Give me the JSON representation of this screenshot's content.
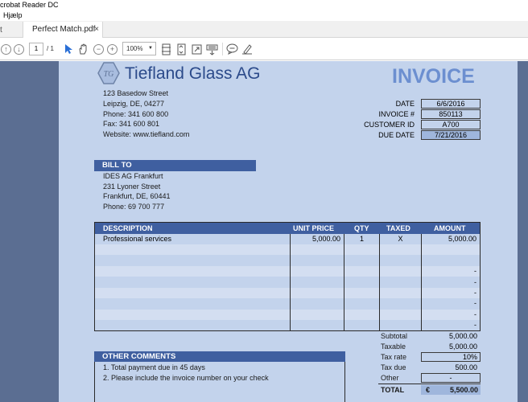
{
  "app": {
    "title": "crobat Reader DC",
    "menu": "Hjælp"
  },
  "tabs": {
    "left_stub": "t",
    "doc_tab": "Perfect Match.pdf",
    "close": "×"
  },
  "toolbar": {
    "page_current": "1",
    "page_total": "/ 1",
    "zoom": "100%"
  },
  "company": {
    "logo_text": "TG",
    "name": "Tiefland Glass AG",
    "address_lines": [
      "123 Basedow Street",
      "Leipzig, DE, 04277",
      "Phone: 341 600 800",
      "Fax: 341 600 801",
      "Website: www.tiefland.com"
    ]
  },
  "invoice": {
    "title": "INVOICE",
    "meta": [
      {
        "label": "DATE",
        "value": "6/6/2016"
      },
      {
        "label": "INVOICE #",
        "value": "850113"
      },
      {
        "label": "CUSTOMER ID",
        "value": "A700"
      },
      {
        "label": "DUE DATE",
        "value": "7/21/2016"
      }
    ]
  },
  "bill_to": {
    "heading": "BILL TO",
    "lines": [
      "IDES AG Frankfurt",
      "231 Lyoner Street",
      "Frankfurt, DE, 60441",
      "Phone: 69 700 777"
    ]
  },
  "items": {
    "headers": [
      "DESCRIPTION",
      "UNIT PRICE",
      "QTY",
      "TAXED",
      "AMOUNT"
    ],
    "rows": [
      {
        "desc": "Professional services",
        "price": "5,000.00",
        "qty": "1",
        "taxed": "X",
        "amount": "5,000.00"
      },
      {
        "desc": "",
        "price": "",
        "qty": "",
        "taxed": "",
        "amount": ""
      },
      {
        "desc": "",
        "price": "",
        "qty": "",
        "taxed": "",
        "amount": ""
      },
      {
        "desc": "",
        "price": "",
        "qty": "",
        "taxed": "",
        "amount": "-"
      },
      {
        "desc": "",
        "price": "",
        "qty": "",
        "taxed": "",
        "amount": "-"
      },
      {
        "desc": "",
        "price": "",
        "qty": "",
        "taxed": "",
        "amount": "-"
      },
      {
        "desc": "",
        "price": "",
        "qty": "",
        "taxed": "",
        "amount": "-"
      },
      {
        "desc": "",
        "price": "",
        "qty": "",
        "taxed": "",
        "amount": "-"
      },
      {
        "desc": "",
        "price": "",
        "qty": "",
        "taxed": "",
        "amount": "-"
      }
    ]
  },
  "totals": [
    {
      "label": "Subtotal",
      "value": "5,000.00",
      "boxed": false
    },
    {
      "label": "Taxable",
      "value": "5,000.00",
      "boxed": false
    },
    {
      "label": "Tax rate",
      "value": "10%",
      "boxed": true
    },
    {
      "label": "Tax due",
      "value": "500.00",
      "boxed": false
    },
    {
      "label": "Other",
      "value": "-",
      "boxed": true
    }
  ],
  "grand_total": {
    "label": "TOTAL",
    "currency": "€",
    "value": "5,500.00"
  },
  "comments": {
    "heading": "OTHER COMMENTS",
    "lines": [
      "1. Total payment due in 45 days",
      "2. Please include the invoice number on your check"
    ]
  },
  "colors": {
    "band": "#3f5fa0",
    "sheet": "#c3d3ec",
    "title": "#6c8fd0",
    "viewport": "#5b6e92"
  }
}
